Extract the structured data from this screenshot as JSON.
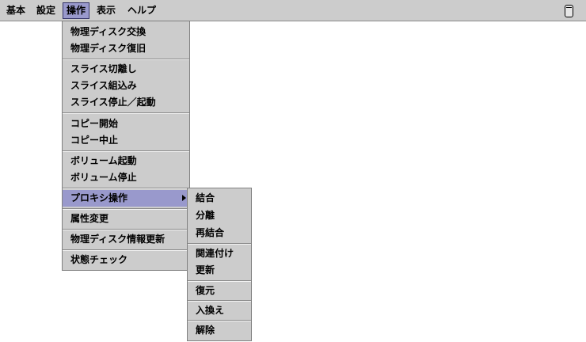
{
  "menubar": {
    "items": [
      "基本",
      "設定",
      "操作",
      "表示",
      "ヘルプ"
    ],
    "active_index": 2,
    "right_icon": "trash-can-icon"
  },
  "operation_menu": {
    "items": [
      "物理ディスク交換",
      "物理ディスク復旧",
      "スライス切離し",
      "スライス組込み",
      "スライス停止／起動",
      "コピー開始",
      "コピー中止",
      "ボリューム起動",
      "ボリューム停止",
      "プロキシ操作",
      "属性変更",
      "物理ディスク情報更新",
      "状態チェック"
    ],
    "selected_index": 9
  },
  "proxy_submenu": {
    "items": [
      "結合",
      "分離",
      "再結合",
      "関連付け",
      "更新",
      "復元",
      "入換え",
      "解除"
    ]
  },
  "colors": {
    "menu_background": "#cccccc",
    "highlight": "#9999cc"
  }
}
